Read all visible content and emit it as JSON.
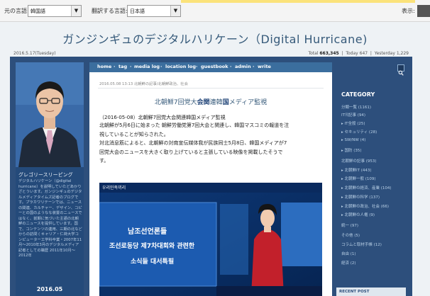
{
  "translate_bar": {
    "source_label": "元の言語:",
    "source_value": "韓国語",
    "target_label": "翻訳する言語:",
    "target_value": "日本語",
    "show_label": "表示:"
  },
  "header": {
    "title": "ガンジンギュのデジタルハリケーン（Digital Hurricane)",
    "date": "2016.5.17(Tuesday)",
    "stats": {
      "total_label": "Total",
      "total": "663,345",
      "today_label": "Today",
      "today": "647",
      "yesterday_label": "Yesterday",
      "yesterday": "1,229"
    }
  },
  "nav": [
    "home",
    "tag",
    "media log",
    "location log",
    "guestbook",
    "admin",
    "write"
  ],
  "profile": {
    "name": "グレゴリースリーピング",
    "description": "デジタルハリケーン（@digital hurricane）を説明していたどあかりざとういます。ガンジンギュのデジタルメディアタイムズ記者のブログです。プラカワリテーンでは、ニュースの関連、カルチャー、デザイン、コピーとの国のようなな装置のニュースではなく、前期に気づいた主語の北朝鮮のニュースを提供しています。国で、コンテンツの連用、三期の北などからの訪問 ( キャリア・仁荷大学コンピューター工学科卒業・2007年11月〜2010年3月のデジタルメディア記者としての職歴 2011年10月〜2012年",
    "year": "2016.05"
  },
  "post": {
    "meta": "2016.05.08 13:13  北朝鮮の記事/北朝鮮政治、社会",
    "title_pre": "北朝鮮7回党大",
    "title_b1": "会関",
    "title_mid": "連韓",
    "title_b2": "国",
    "title_post": "メディア監視",
    "lines": [
      "（2016-05-08）北朝鮮7回党大会関連韓国メディア監視",
      "北朝鮮が5月6日に始まった 朝鮮労働党第7回大会と関連し、韓国マスコミの報道を注",
      "視していることが知らされた。",
      "対北消息筋によると、北朝鮮の対南宣伝媒体我が民族同士5月8日、韓国メディアが7",
      "回党大会のニュースを大きく取り上げていると主張している映像を掲載したそうで",
      "す。"
    ],
    "video_caption_1": "남조선언론들",
    "video_caption_2": "조선로동당 제7차대회와 관련한",
    "video_caption_3": "소식들 대서특필",
    "video_logo": "우리민족끼리"
  },
  "sidebar": {
    "category_title": "CATEGORY",
    "items": [
      "分類一覧 (1161)",
      "IT의記事 (94)",
      "▸ IT全般 (25)",
      "▸ セキュリティ (28)",
      "▸ SW/NW (4)",
      "▸ 国防 (35)",
      "北朝鮮の記事 (953)",
      "▸ 北朝鮮IT (443)",
      "▸ 北朝鮮一般 (109)",
      "▸ 北朝鮮の経済、産業 (104)",
      "▸ 北朝鮮の科学 (137)",
      "▸ 北朝鮮の政治、社会 (66)",
      "▸ 北朝鮮の人権 (9)",
      "統一 (97)",
      "その他 (5)",
      "コラムと取材手帳 (12)",
      "自由 (1)",
      "経済 (2)"
    ],
    "recent_title": "RECENT POST"
  },
  "colors": {
    "frame": "#2d4f7c",
    "nav": "#3b6e9e",
    "title": "#365a7a"
  }
}
